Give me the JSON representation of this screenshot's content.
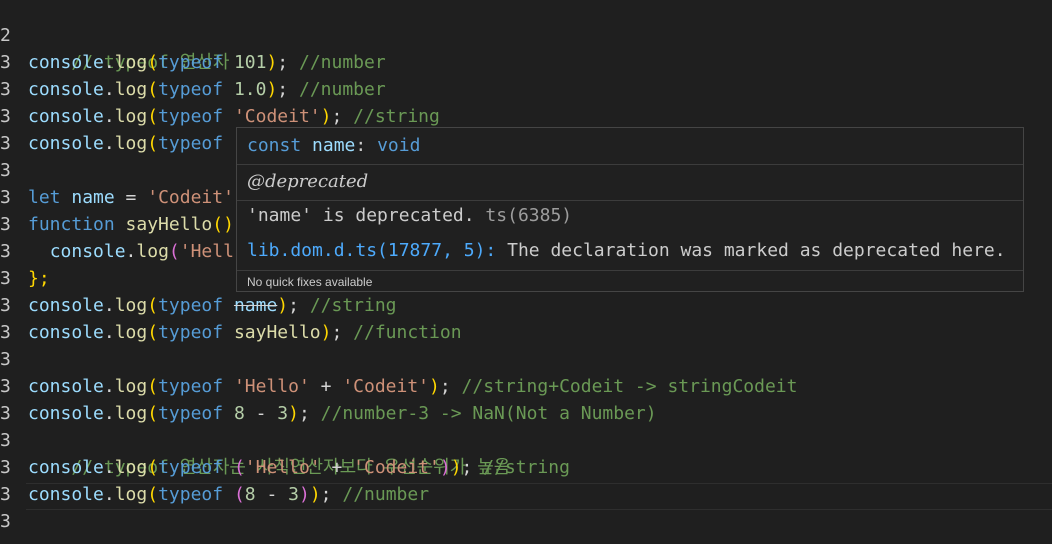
{
  "gutter": {
    "glyphs": [
      "2",
      "3",
      "3",
      "3",
      "3",
      "3",
      "3",
      "3",
      "3",
      "3",
      "3",
      "3",
      "3",
      "3",
      "3",
      "3",
      "3",
      "3",
      "3"
    ]
  },
  "code": {
    "l1": {
      "comment": "// typeof 연산자"
    },
    "console": "console",
    "log": "log",
    "typeof": "typeof",
    "dot": ".",
    "open": "(",
    "close": ")",
    "semi": ";",
    "l2": {
      "num": "101",
      "comment": " //number"
    },
    "l3": {
      "num": "1.0",
      "comment": " //number"
    },
    "l4": {
      "str": "'Codeit'",
      "comment": " //string"
    },
    "l6": {
      "kw": "let",
      "name": "name",
      "eq": " = ",
      "str": "'Codeit'"
    },
    "l7": {
      "kw": "function",
      "fn": "sayHello",
      "paren": "()"
    },
    "l8": {
      "indent": "  ",
      "str": "'Hell"
    },
    "l9": {
      "text": "};"
    },
    "l10": {
      "ident": "name",
      "comment": " //string"
    },
    "l11": {
      "ident": "sayHello",
      "comment": " //function"
    },
    "l13": {
      "str1": "'Hello'",
      "plus": " + ",
      "str2": "'Codeit'",
      "comment": " //string+Codeit -> stringCodeit"
    },
    "l14": {
      "num1": "8",
      "minus": " - ",
      "num2": "3",
      "comment": " //number-3 -> NaN(Not a Number)"
    },
    "l15": {
      "comment": "// typeof 연산자는 사칙연산자보다 우선순위가 높음"
    },
    "l16": {
      "str1": "'Hello'",
      "plus": " + ",
      "str2": "'Codeit'",
      "comment": " //string"
    },
    "l17": {
      "num1": "8",
      "minus": " - ",
      "num2": "3",
      "comment": " //number"
    }
  },
  "hover": {
    "signature": {
      "kw": "const",
      "name": "name",
      "colon": ": ",
      "type": "void"
    },
    "tag": "@deprecated",
    "message": {
      "code": "'name'",
      "text": " is deprecated.",
      "ts": " ts(6385)"
    },
    "link": {
      "location": "lib.dom.d.ts(17877, 5)",
      "colon": ":",
      "text": " The declaration was marked as deprecated here."
    },
    "status": "No quick fixes available"
  },
  "colors": {
    "background": "#1f1f1f",
    "keyword": "#569cd6",
    "function": "#dcdcaa",
    "variable": "#9cdcfe",
    "string": "#ce9178",
    "number": "#b5cea8",
    "comment": "#6a9955",
    "link": "#4daafc"
  }
}
